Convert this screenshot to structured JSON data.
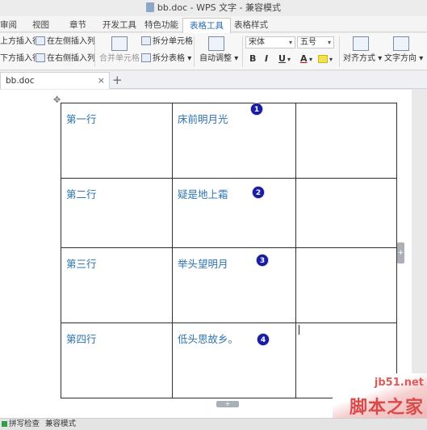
{
  "window": {
    "title": "bb.doc - WPS 文字 - 兼容模式"
  },
  "menu_tabs": [
    {
      "label": "审阅"
    },
    {
      "label": "视图"
    },
    {
      "label": "章节"
    },
    {
      "label": "开发工具"
    },
    {
      "label": "特色功能"
    },
    {
      "label": "表格工具",
      "active": true
    },
    {
      "label": "表格样式"
    }
  ],
  "ribbon": {
    "insert_above": "上方插入行",
    "insert_below": "下方插入行",
    "insert_left": "在左侧插入列",
    "insert_right": "在右侧插入列",
    "merge_cells": "合并单元格",
    "split_cells": "拆分单元格",
    "split_table": "拆分表格",
    "auto_fit": "自动调整",
    "font_name": "宋体",
    "font_size": "五号",
    "bold": "B",
    "italic": "I",
    "underline": "U",
    "font_color": "A",
    "align": "对齐方式",
    "text_direction": "文字方向",
    "dropdown_arrow": "▾"
  },
  "doc_tab": {
    "name": "bb.doc",
    "close": "×",
    "add": "+"
  },
  "table": {
    "rows": [
      {
        "label": "第一行",
        "poem": "床前明月光",
        "badge": "1"
      },
      {
        "label": "第二行",
        "poem": "疑是地上霜",
        "badge": "2"
      },
      {
        "label": "第三行",
        "poem": "举头望明月",
        "badge": "3"
      },
      {
        "label": "第四行",
        "poem": "低头思故乡。",
        "badge": "4"
      }
    ]
  },
  "handles": {
    "move": "✥",
    "row_add": "+",
    "col_add": "+"
  },
  "status": {
    "spellcheck": "拼写检查",
    "compat": "兼容模式"
  },
  "watermark": {
    "url": "jb51.net",
    "name": "脚本之家"
  },
  "colors": {
    "accent": "#2b73b0",
    "badge": "#1a1fb0"
  }
}
